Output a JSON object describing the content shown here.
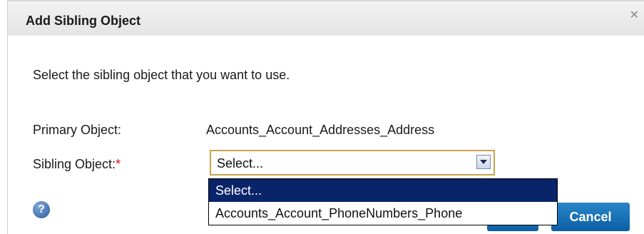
{
  "dialog": {
    "title": "Add Sibling Object",
    "close_glyph": "✕"
  },
  "instruction": "Select the sibling object that you want to use.",
  "primary": {
    "label": "Primary Object:",
    "value": "Accounts_Account_Addresses_Address"
  },
  "sibling": {
    "label": "Sibling Object:",
    "required_marker": "*",
    "selected": "Select...",
    "options": [
      "Select...",
      "Accounts_Account_PhoneNumbers_Phone"
    ]
  },
  "help_glyph": "?",
  "buttons": {
    "cancel": "Cancel"
  },
  "colors": {
    "selected_option_bg": "#0a246a",
    "button_blue": "#0b5fa5",
    "required": "#e01010"
  },
  "icons": {
    "close": "close-icon",
    "dropdown": "chevron-down-icon",
    "help": "help-icon"
  }
}
